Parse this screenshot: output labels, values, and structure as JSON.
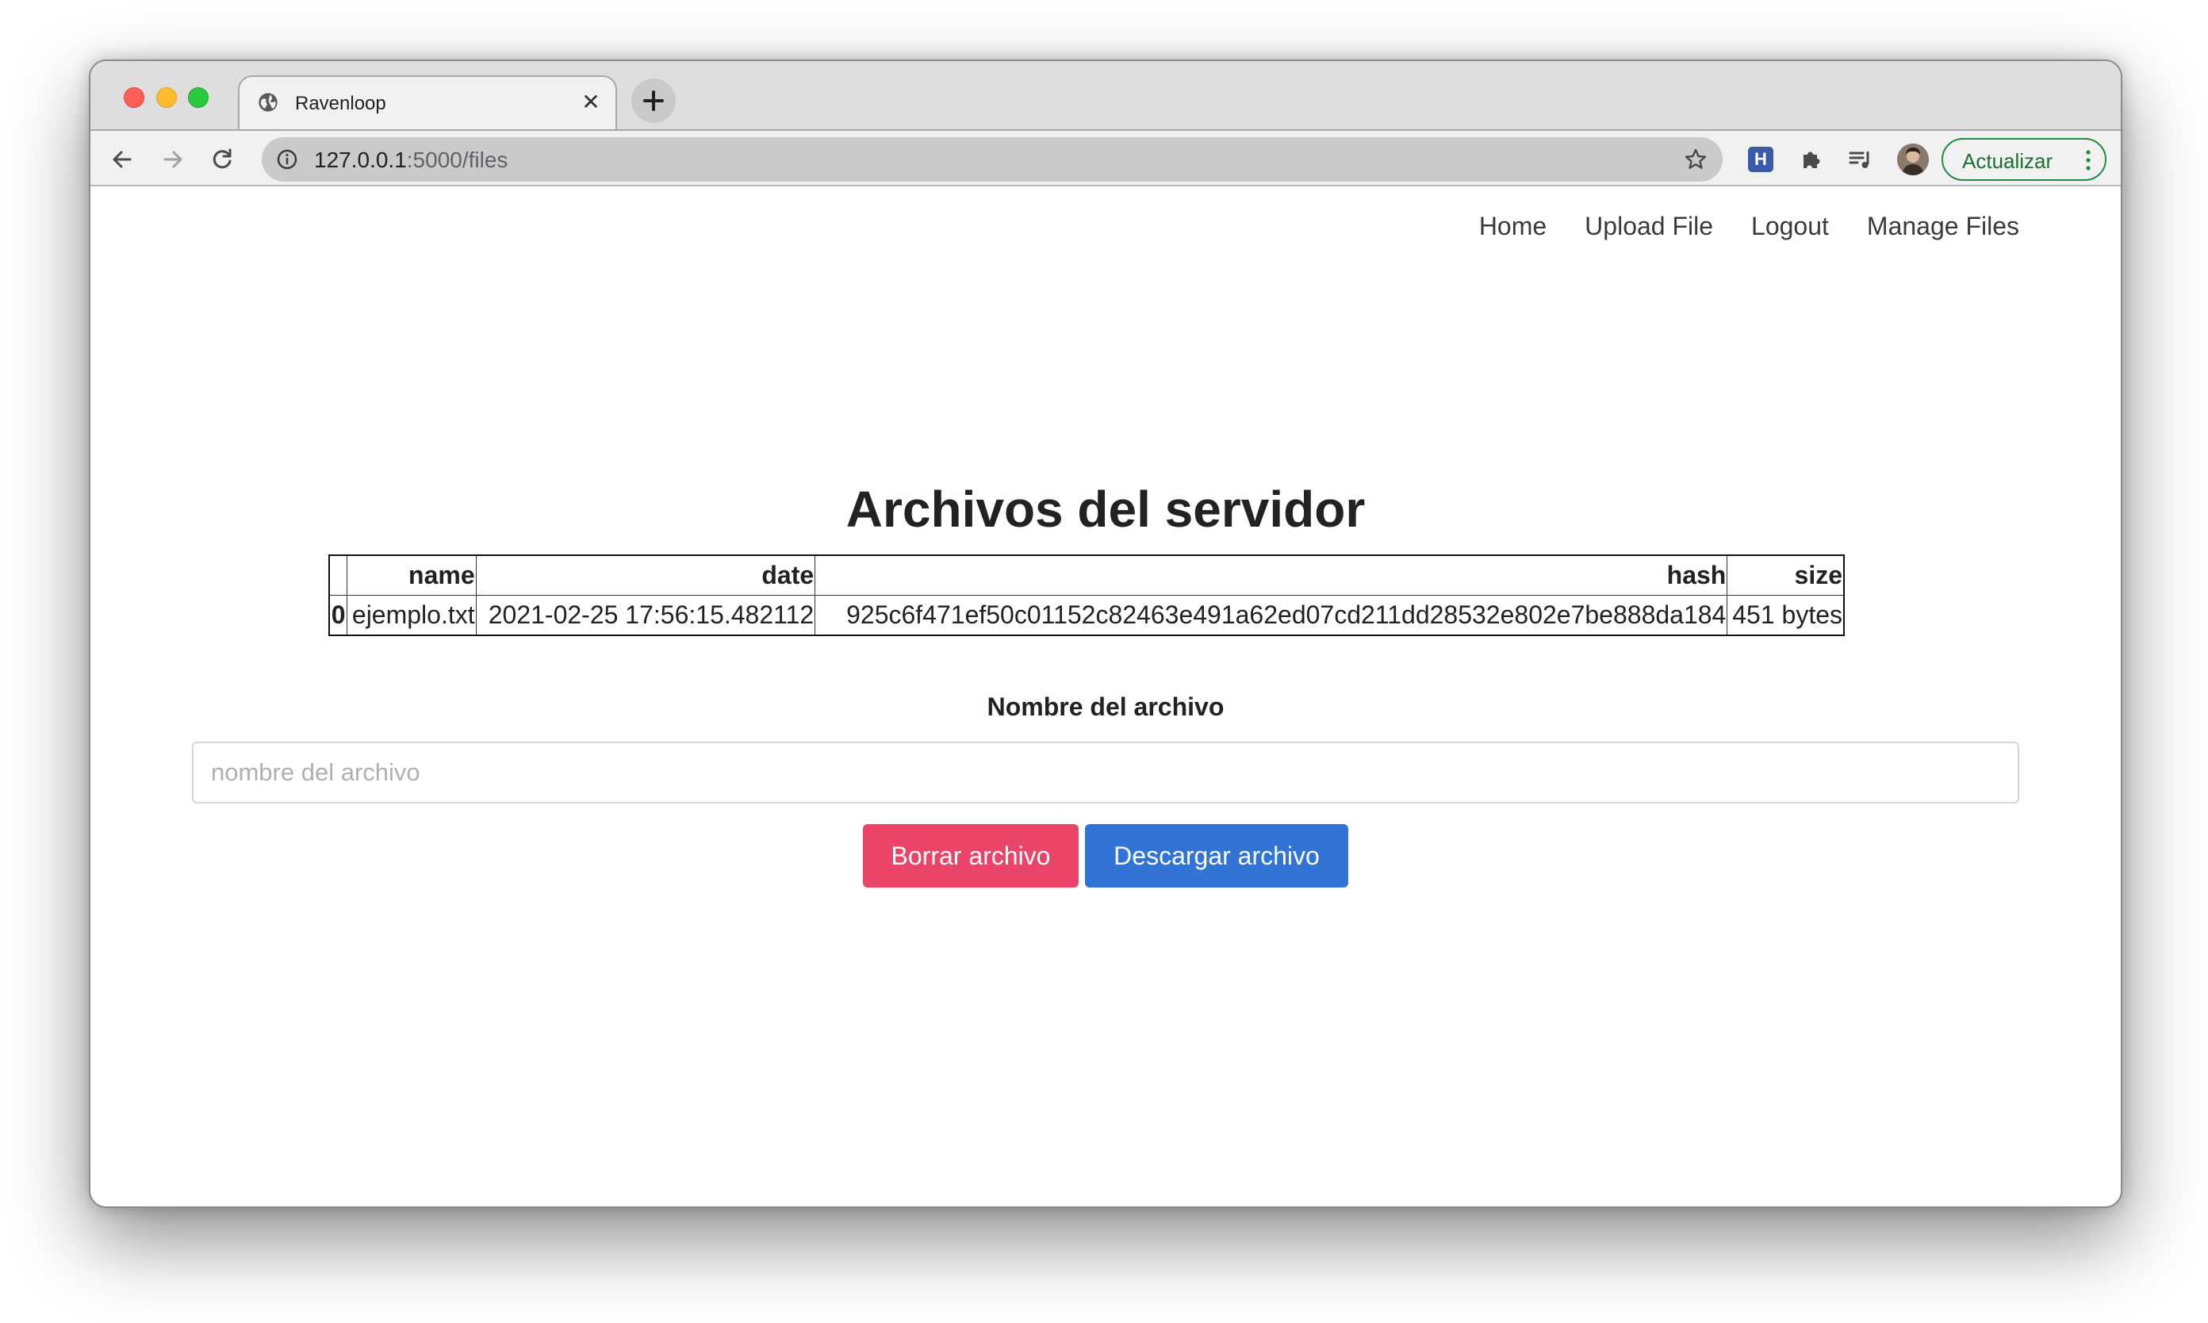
{
  "browser": {
    "tab": {
      "title": "Ravenloop",
      "close_glyph": "✕"
    },
    "new_tab_glyph": "+",
    "url": {
      "host": "127.0.0.1",
      "rest": ":5000/files"
    },
    "extension_h": "H",
    "update_button": "Actualizar"
  },
  "nav": {
    "items": [
      {
        "label": "Home"
      },
      {
        "label": "Upload File"
      },
      {
        "label": "Logout"
      },
      {
        "label": "Manage Files"
      }
    ]
  },
  "main": {
    "title": "Archivos del servidor",
    "table": {
      "headers": [
        "",
        "name",
        "date",
        "hash",
        "size"
      ],
      "rows": [
        [
          "0",
          "ejemplo.txt",
          "2021-02-25 17:56:15.482112",
          "925c6f471ef50c01152c82463e491a62ed07cd211dd28532e802e7be888da184",
          "451 bytes"
        ]
      ]
    },
    "form": {
      "label": "Nombre del archivo",
      "placeholder": "nombre del archivo",
      "value": "",
      "delete_button": "Borrar archivo",
      "download_button": "Descargar archivo"
    }
  },
  "colors": {
    "delete_button": "#ea4568",
    "download_button": "#3274d6",
    "update_button_border": "#1e8e3e"
  },
  "icons": [
    "globe-icon",
    "close-icon",
    "plus-icon",
    "back-arrow-icon",
    "forward-arrow-icon",
    "reload-icon",
    "info-icon",
    "star-icon",
    "puzzle-icon",
    "media-queue-icon",
    "more-vert-icon"
  ]
}
